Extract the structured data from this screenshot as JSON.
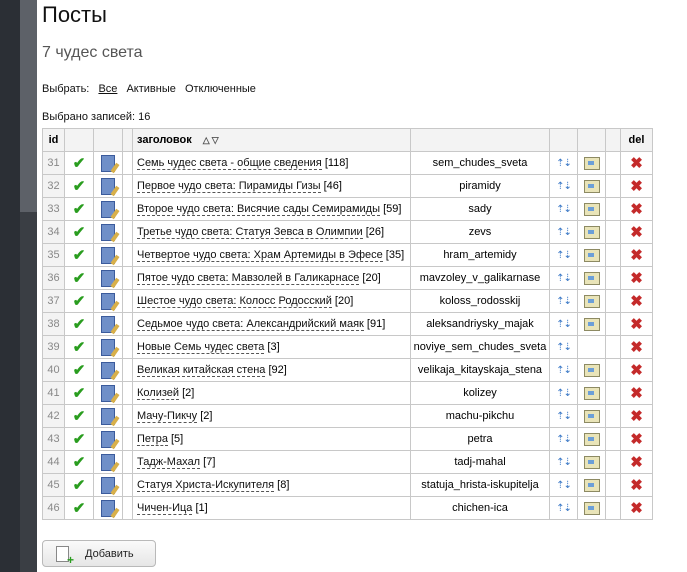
{
  "page": {
    "title": "Посты",
    "subtitle": "7 чудес света",
    "filter": {
      "label": "Выбрать:",
      "options": [
        "Все",
        "Активные",
        "Отключенные"
      ],
      "active": "Все"
    },
    "count_text": "Выбрано записей: 16"
  },
  "table": {
    "headers": {
      "id": "id",
      "title": "заголовок",
      "del": "del"
    },
    "rows": [
      {
        "id": "31",
        "title": "Семь чудес света - общие сведения",
        "count": "[118]",
        "alias": "sem_chudes_sveta",
        "link": true
      },
      {
        "id": "32",
        "title": "Первое чудо света: Пирамиды Гизы",
        "count": "[46]",
        "alias": "piramidy",
        "link": true
      },
      {
        "id": "33",
        "title": "Второе чудо света: Висячие сады Семирамиды",
        "count": "[59]",
        "alias": "sady",
        "link": true
      },
      {
        "id": "34",
        "title": "Третье чудо света: Статуя Зевса в Олимпии",
        "count": "[26]",
        "alias": "zevs",
        "link": true
      },
      {
        "id": "35",
        "title": "Четвертое чудо света: Храм Артемиды в Эфесе",
        "count": "[35]",
        "alias": "hram_artemidy",
        "link": true
      },
      {
        "id": "36",
        "title": "Пятое чудо света: Мавзолей в Галикарнасе",
        "count": "[20]",
        "alias": "mavzoley_v_galikarnase",
        "link": true
      },
      {
        "id": "37",
        "title": "Шестое чудо света: Колосс Родосский",
        "count": "[20]",
        "alias": "koloss_rodosskij",
        "link": true
      },
      {
        "id": "38",
        "title": "Седьмое чудо света: Александрийский маяк",
        "count": "[91]",
        "alias": "aleksandriysky_majak",
        "link": true
      },
      {
        "id": "39",
        "title": "Новые Семь чудес света",
        "count": "[3]",
        "alias": "noviye_sem_chudes_sveta",
        "link": false
      },
      {
        "id": "40",
        "title": "Великая китайская стена",
        "count": "[92]",
        "alias": "velikaja_kitayskaja_stena",
        "link": true
      },
      {
        "id": "41",
        "title": "Колизей",
        "count": "[2]",
        "alias": "kolizey",
        "link": true
      },
      {
        "id": "42",
        "title": "Мачу-Пикчу",
        "count": "[2]",
        "alias": "machu-pikchu",
        "link": true
      },
      {
        "id": "43",
        "title": "Петра",
        "count": "[5]",
        "alias": "petra",
        "link": true
      },
      {
        "id": "44",
        "title": "Тадж-Махал",
        "count": "[7]",
        "alias": "tadj-mahal",
        "link": true
      },
      {
        "id": "45",
        "title": "Статуя Христа-Искупителя",
        "count": "[8]",
        "alias": "statuja_hrista-iskupitelja",
        "link": true
      },
      {
        "id": "46",
        "title": "Чичен-Ица",
        "count": "[1]",
        "alias": "chichen-ica",
        "link": true
      }
    ]
  },
  "add_button": {
    "label": "Добавить"
  },
  "colors": {
    "check": "#2a9d1f",
    "delete": "#c42a2a",
    "sidebar": "#2b2f35"
  }
}
